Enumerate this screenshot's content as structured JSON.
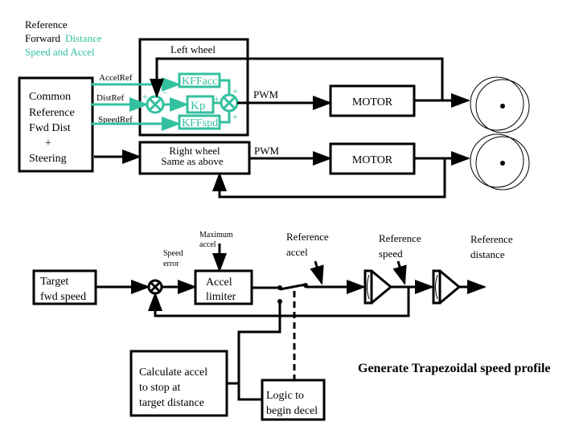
{
  "colors": {
    "accent": "#33c0a0",
    "line": "#000000"
  },
  "title": {
    "line1": "Reference",
    "line2a": "Forward",
    "line2b": "Distance",
    "line3": "Speed and Accel"
  },
  "left_wheel": {
    "label": "Left wheel",
    "kffacc": "KFFacc",
    "kp": "Kp",
    "kffspd": "KFFspd",
    "plus": "+",
    "minus": "−"
  },
  "common": {
    "lines": [
      "Common",
      "Reference",
      "Fwd Dist",
      "+",
      "Steering"
    ]
  },
  "signals": {
    "accel_ref": "AccelRef",
    "dist_ref": "DistRef",
    "speed_ref": "SpeedRef",
    "pwm1": "PWM",
    "pwm2": "PWM"
  },
  "right_wheel": {
    "line1": "Right wheel",
    "line2": "Same as above"
  },
  "motors": [
    "MOTOR",
    "MOTOR"
  ],
  "profile": {
    "target": [
      "Target",
      "fwd speed"
    ],
    "speed_error": [
      "Speed",
      "error"
    ],
    "max_accel": [
      "Maximum",
      "accel"
    ],
    "limiter": [
      "Accel",
      "limiter"
    ],
    "ref_accel": [
      "Reference",
      "accel"
    ],
    "ref_speed": [
      "Reference",
      "speed"
    ],
    "ref_distance": [
      "Reference",
      "distance"
    ],
    "calc": [
      "Calculate accel",
      "to stop at",
      "target distance"
    ],
    "logic": [
      "Logic to",
      "begin decel"
    ],
    "caption": "Generate Trapezoidal speed profile"
  }
}
